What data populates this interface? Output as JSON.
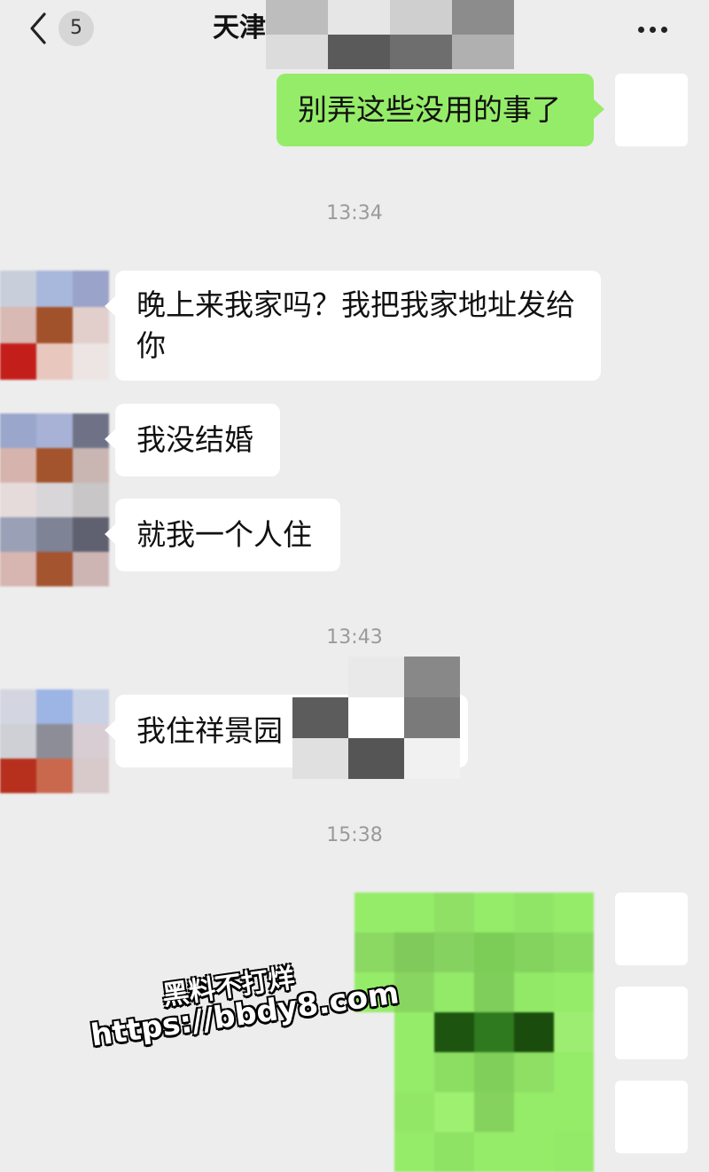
{
  "header": {
    "unread_count": "5",
    "title": "天津"
  },
  "messages": [
    {
      "side": "out",
      "text": "别弄这些没用的事了"
    },
    {
      "type": "time",
      "text": "13:34"
    },
    {
      "side": "in",
      "line1": "晚上来我家吗？我把我家地址发给",
      "line2": "你"
    },
    {
      "side": "in",
      "text": "我没结婚"
    },
    {
      "side": "in",
      "text": "就我一个人住"
    },
    {
      "type": "time",
      "text": "13:43"
    },
    {
      "side": "in",
      "text": "我住祥景园"
    },
    {
      "type": "time",
      "text": "15:38"
    }
  ],
  "watermark": {
    "line1": "黑料不打烊",
    "line2": "https://bbdy8.com"
  },
  "colors": {
    "background": "#ededed",
    "incoming_bubble": "#ffffff",
    "outgoing_bubble": "#95ec69"
  }
}
